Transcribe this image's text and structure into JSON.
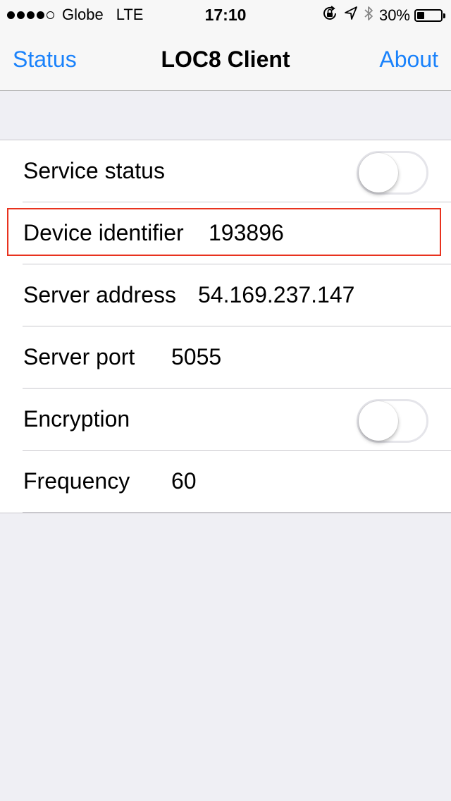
{
  "status_bar": {
    "signal_dots": 5,
    "signal_filled": 4,
    "carrier": "Globe",
    "network": "LTE",
    "time": "17:10",
    "icons": [
      "orientation-lock-icon",
      "location-arrow-icon",
      "bluetooth-icon"
    ],
    "battery": "30%",
    "battery_level": 0.3
  },
  "nav": {
    "left": "Status",
    "title": "LOC8 Client",
    "right": "About"
  },
  "rows": [
    {
      "label": "Service status",
      "type": "toggle",
      "on": false
    },
    {
      "label": "Device identifier",
      "value": "193896",
      "highlighted": true
    },
    {
      "label": "Server address",
      "value": "54.169.237.147"
    },
    {
      "label": "Server port",
      "value": "5055"
    },
    {
      "label": "Encryption",
      "type": "toggle",
      "on": false
    },
    {
      "label": "Frequency",
      "value": "60"
    }
  ],
  "colors": {
    "accent": "#1a82fb",
    "background": "#efeff4",
    "highlight": "#e8321e"
  }
}
